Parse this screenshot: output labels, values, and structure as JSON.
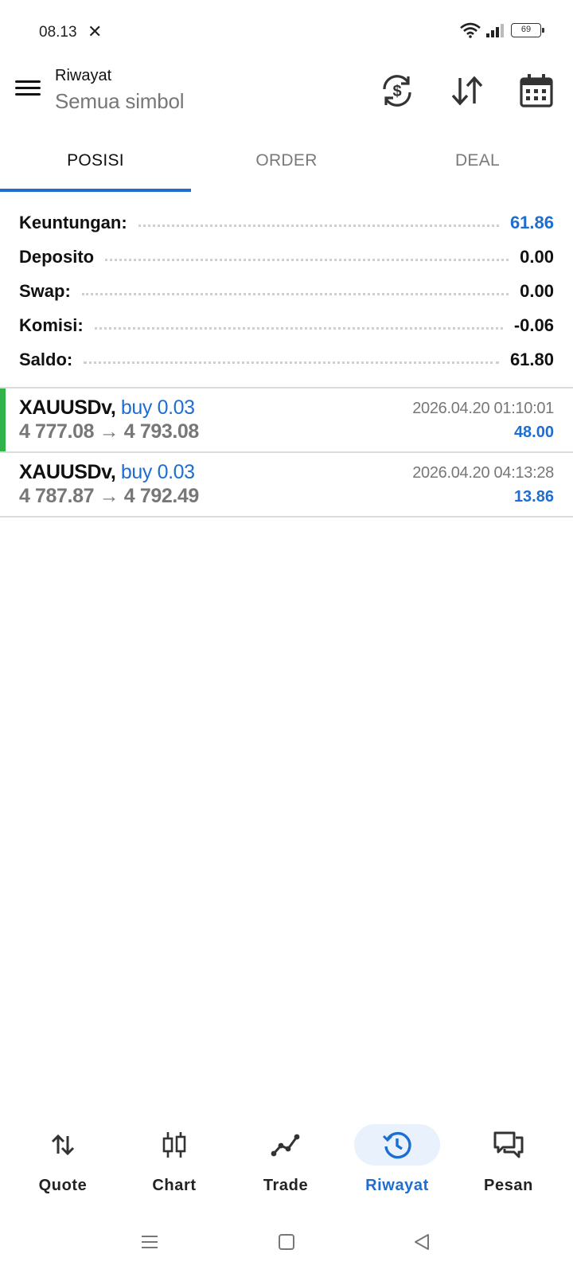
{
  "status_bar": {
    "time": "08.13",
    "battery": "69",
    "icons": [
      "close-x-icon",
      "wifi-icon",
      "signal-icon",
      "battery-icon"
    ]
  },
  "header": {
    "title": "Riwayat",
    "subtitle": "Semua simbol",
    "actions": [
      "currency-sync-icon",
      "sort-icon",
      "calendar-icon"
    ]
  },
  "tabs": [
    {
      "label": "POSISI",
      "active": true
    },
    {
      "label": "ORDER",
      "active": false
    },
    {
      "label": "DEAL",
      "active": false
    }
  ],
  "summary": [
    {
      "label": "Keuntungan:",
      "value": "61.86",
      "highlight": true
    },
    {
      "label": "Deposito",
      "value": "0.00",
      "highlight": false
    },
    {
      "label": "Swap:",
      "value": "0.00",
      "highlight": false
    },
    {
      "label": "Komisi:",
      "value": "-0.06",
      "highlight": false
    },
    {
      "label": "Saldo:",
      "value": "61.80",
      "highlight": false
    }
  ],
  "trades": [
    {
      "symbol": "XAUUSDv,",
      "side": "buy 0.03",
      "prices": "4 777.08 → 4 793.08",
      "time": "2026.04.20 01:10:01",
      "profit": "48.00"
    },
    {
      "symbol": "XAUUSDv,",
      "side": "buy 0.03",
      "prices": "4 787.87 → 4 792.49",
      "time": "2026.04.20 04:13:28",
      "profit": "13.86"
    }
  ],
  "bottom_nav": [
    {
      "label": "Quote",
      "icon": "quote-arrows-icon",
      "active": false
    },
    {
      "label": "Chart",
      "icon": "candlestick-icon",
      "active": false
    },
    {
      "label": "Trade",
      "icon": "trade-line-icon",
      "active": false
    },
    {
      "label": "Riwayat",
      "icon": "history-clock-icon",
      "active": true
    },
    {
      "label": "Pesan",
      "icon": "chat-icon",
      "active": false
    }
  ],
  "colors": {
    "accent": "#1e6ed2",
    "profit_bar": "#2fb34a",
    "muted": "#777777"
  }
}
